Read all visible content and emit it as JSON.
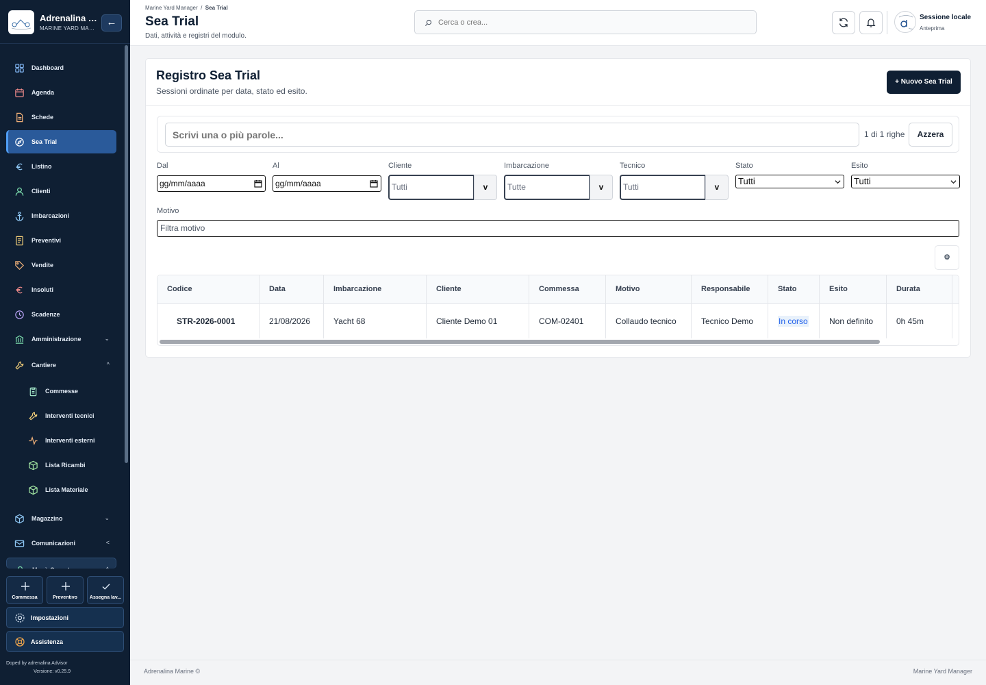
{
  "app": {
    "title": "Adrenalina M...",
    "subtitle": "MARINE YARD MANA...",
    "collapse_label": "←"
  },
  "sidebar": {
    "items": [
      {
        "label": "Dashboard",
        "icon": "grid-icon"
      },
      {
        "label": "Agenda",
        "icon": "calendar-icon"
      },
      {
        "label": "Schede",
        "icon": "document-icon"
      },
      {
        "label": "Sea Trial",
        "icon": "compass-icon",
        "active": true
      },
      {
        "label": "Listino",
        "icon": "euro-icon"
      },
      {
        "label": "Clienti",
        "icon": "user-icon"
      },
      {
        "label": "Imbarcazioni",
        "icon": "anchor-icon"
      },
      {
        "label": "Preventivi",
        "icon": "receipt-icon"
      },
      {
        "label": "Vendite",
        "icon": "tag-icon"
      },
      {
        "label": "Insoluti",
        "icon": "euro-icon"
      },
      {
        "label": "Scadenze",
        "icon": "clock-icon"
      },
      {
        "label": "Amministrazione",
        "icon": "bank-icon",
        "chevron": "⌄"
      },
      {
        "label": "Cantiere",
        "icon": "wrench-icon",
        "chevron": "^"
      },
      {
        "label": "Commesse",
        "icon": "clipboard-icon",
        "sub": true
      },
      {
        "label": "Interventi tecnici",
        "icon": "wrench-icon",
        "sub": true
      },
      {
        "label": "Interventi esterni",
        "icon": "activity-icon",
        "sub": true
      },
      {
        "label": "Lista Ricambi",
        "icon": "box-icon",
        "sub": true
      },
      {
        "label": "Lista Materiale",
        "icon": "box-icon",
        "sub": true
      },
      {
        "label": "Magazzino",
        "icon": "package-icon",
        "chevron": "⌄"
      },
      {
        "label": "Comunicazioni",
        "icon": "mail-icon",
        "chevron": "<"
      },
      {
        "label": "Menù Operatore",
        "icon": "user-icon",
        "chevron": "^"
      }
    ],
    "quick_actions": [
      {
        "label": "Commessa",
        "icon": "plus-icon"
      },
      {
        "label": "Preventivo",
        "icon": "plus-icon"
      },
      {
        "label": "Assegna lav...",
        "icon": "check-icon"
      }
    ],
    "settings_label": "Impostazioni",
    "support_label": "Assistenza",
    "credits": "Doped by adrenalina Advisor",
    "version": "Versione: v0.25.9"
  },
  "header": {
    "breadcrumb_root": "Marine Yard Manager",
    "breadcrumb_sep": "/",
    "breadcrumb_current": "Sea Trial",
    "title": "Sea Trial",
    "subtitle": "Dati, attività e registri del modulo.",
    "search_placeholder": "Cerca o crea...",
    "session_name": "Sessione locale",
    "session_mode": "Anteprima"
  },
  "card": {
    "title": "Registro Sea Trial",
    "subtitle": "Sessioni ordinate per data, stato ed esito.",
    "new_button": "+ Nuovo Sea Trial"
  },
  "filters": {
    "fulltext_placeholder": "Scrivi una o più parole...",
    "rows_info": "1 di 1 righe",
    "reset_label": "Azzera",
    "dal_label": "Dal",
    "dal_value": "gg/mm/aaaa",
    "al_label": "Al",
    "al_value": "gg/mm/aaaa",
    "cliente_label": "Cliente",
    "cliente_placeholder": "Tutti",
    "imbarcazione_label": "Imbarcazione",
    "imbarcazione_placeholder": "Tutte",
    "tecnico_label": "Tecnico",
    "tecnico_placeholder": "Tutti",
    "combo_button": "v",
    "stato_label": "Stato",
    "stato_value": "Tutti",
    "esito_label": "Esito",
    "esito_value": "Tutti",
    "motivo_label": "Motivo",
    "motivo_placeholder": "Filtra motivo",
    "columns_button": "⚙"
  },
  "table": {
    "columns": [
      "Codice",
      "Data",
      "Imbarcazione",
      "Cliente",
      "Commessa",
      "Motivo",
      "Responsabile",
      "Stato",
      "Esito",
      "Durata"
    ],
    "rows": [
      [
        "STR-2026-0001",
        "21/08/2026",
        "Yacht 68",
        "Cliente Demo 01",
        "COM-02401",
        "Collaudo tecnico",
        "Tecnico Demo",
        "In corso",
        "Non definito",
        "0h 45m"
      ]
    ]
  },
  "footer": {
    "left": "Adrenalina Marine ©",
    "right": "Marine Yard Manager"
  },
  "colors": {
    "sidebar_bg": "#0f1f33",
    "active_bg": "#2a5a9a",
    "primary_button": "#0f1f33",
    "link": "#2563eb"
  }
}
